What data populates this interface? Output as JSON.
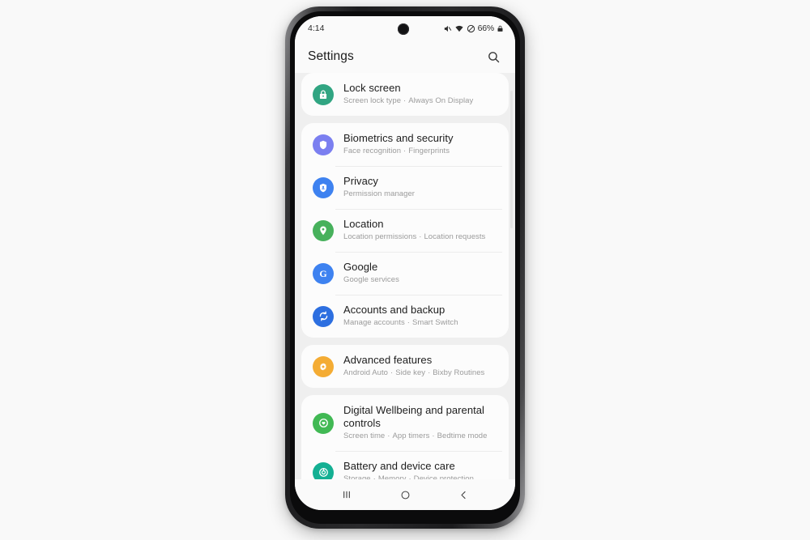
{
  "status_bar": {
    "time": "4:14",
    "battery_percent": "66%",
    "icons": [
      "mute-icon",
      "wifi-icon",
      "do-not-disturb-icon",
      "lock-icon"
    ]
  },
  "header": {
    "title": "Settings",
    "search_icon": "search-icon"
  },
  "sections": [
    {
      "rows": [
        {
          "title": "Lock screen",
          "subtitle_parts": [
            "Screen lock type",
            "Always On Display"
          ],
          "icon": "padlock-icon",
          "icon_color": "#31a582"
        }
      ]
    },
    {
      "rows": [
        {
          "title": "Biometrics and security",
          "subtitle_parts": [
            "Face recognition",
            "Fingerprints"
          ],
          "icon": "shield-icon",
          "icon_color": "#7b7ff0"
        },
        {
          "title": "Privacy",
          "subtitle_parts": [
            "Permission manager"
          ],
          "icon": "privacy-shield-icon",
          "icon_color": "#3e82f0"
        },
        {
          "title": "Location",
          "subtitle_parts": [
            "Location permissions",
            "Location requests"
          ],
          "icon": "location-pin-icon",
          "icon_color": "#47b15c"
        },
        {
          "title": "Google",
          "subtitle_parts": [
            "Google services"
          ],
          "icon": "google-g-icon",
          "icon_color": "#3e82f0"
        },
        {
          "title": "Accounts and backup",
          "subtitle_parts": [
            "Manage accounts",
            "Smart Switch"
          ],
          "icon": "sync-icon",
          "icon_color": "#2d6fe0"
        }
      ]
    },
    {
      "rows": [
        {
          "title": "Advanced features",
          "subtitle_parts": [
            "Android Auto",
            "Side key",
            "Bixby Routines"
          ],
          "icon": "gear-icon",
          "icon_color": "#f4ac34"
        }
      ]
    },
    {
      "rows": [
        {
          "title": "Digital Wellbeing and parental controls",
          "subtitle_parts": [
            "Screen time",
            "App timers",
            "Bedtime mode"
          ],
          "icon": "wellbeing-icon",
          "icon_color": "#41b954"
        },
        {
          "title": "Battery and device care",
          "subtitle_parts": [
            "Storage",
            "Memory",
            "Device protection"
          ],
          "icon": "device-care-icon",
          "icon_color": "#14b093"
        }
      ]
    }
  ],
  "nav_bar": {
    "recents": "recents-icon",
    "home": "home-icon",
    "back": "back-icon"
  },
  "separator_dot": "·"
}
